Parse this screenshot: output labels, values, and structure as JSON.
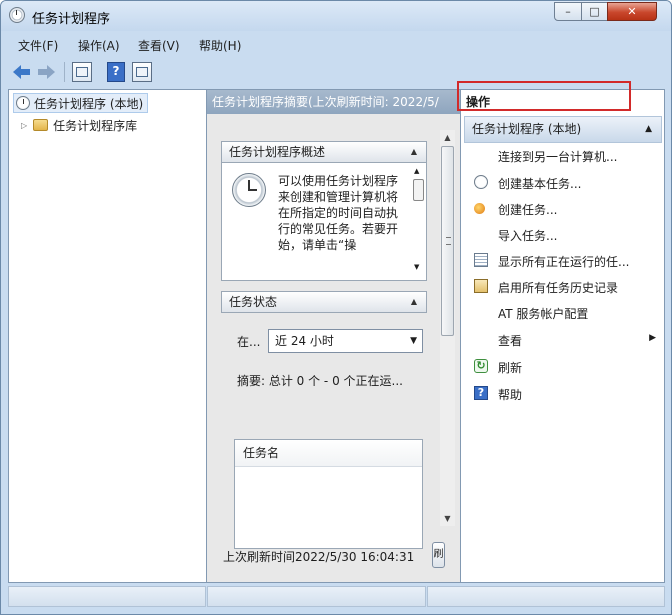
{
  "window": {
    "title": "任务计划程序",
    "controls": {
      "minimize": "–",
      "maximize": "□",
      "close": "✕"
    }
  },
  "menu": [
    "文件(F)",
    "操作(A)",
    "查看(V)",
    "帮助(H)"
  ],
  "toolbar": {
    "help_glyph": "?"
  },
  "tree": {
    "root": "任务计划程序 (本地)",
    "children": [
      {
        "label": "任务计划程序库",
        "expander": "▷"
      }
    ]
  },
  "middle": {
    "header": "任务计划程序摘要(上次刷新时间: 2022/5/",
    "overview": {
      "title": "任务计划程序概述",
      "text": "可以使用任务计划程序来创建和管理计算机将在所指定的时间自动执行的常见任务。若要开始，请单击“操"
    },
    "status": {
      "title": "任务状态",
      "range_label": "在...",
      "range_value": "近 24 小时",
      "summary": "摘要: 总计 0 个 - 0 个正在运...",
      "table_header": "任务名"
    },
    "last_refresh": "上次刷新时间2022/5/30 16:04:31",
    "refresh_button": "刷"
  },
  "actions": {
    "title": "操作",
    "group": "任务计划程序 (本地)",
    "items": [
      {
        "label": "连接到另一台计算机...",
        "icon": "none"
      },
      {
        "label": "创建基本任务...",
        "icon": "clock-icon",
        "highlighted": true
      },
      {
        "label": "创建任务...",
        "icon": "task-icon"
      },
      {
        "label": "导入任务...",
        "icon": "none"
      },
      {
        "label": "显示所有正在运行的任...",
        "icon": "list-icon"
      },
      {
        "label": "启用所有任务历史记录",
        "icon": "history-icon"
      },
      {
        "label": "AT 服务帐户配置",
        "icon": "none"
      },
      {
        "label": "查看",
        "icon": "none",
        "submenu": true
      },
      {
        "label": "刷新",
        "icon": "refresh-icon"
      },
      {
        "label": "帮助",
        "icon": "help-icon"
      }
    ]
  },
  "colors": {
    "highlight": "#d22a2a",
    "accent": "#3a6fc7"
  }
}
